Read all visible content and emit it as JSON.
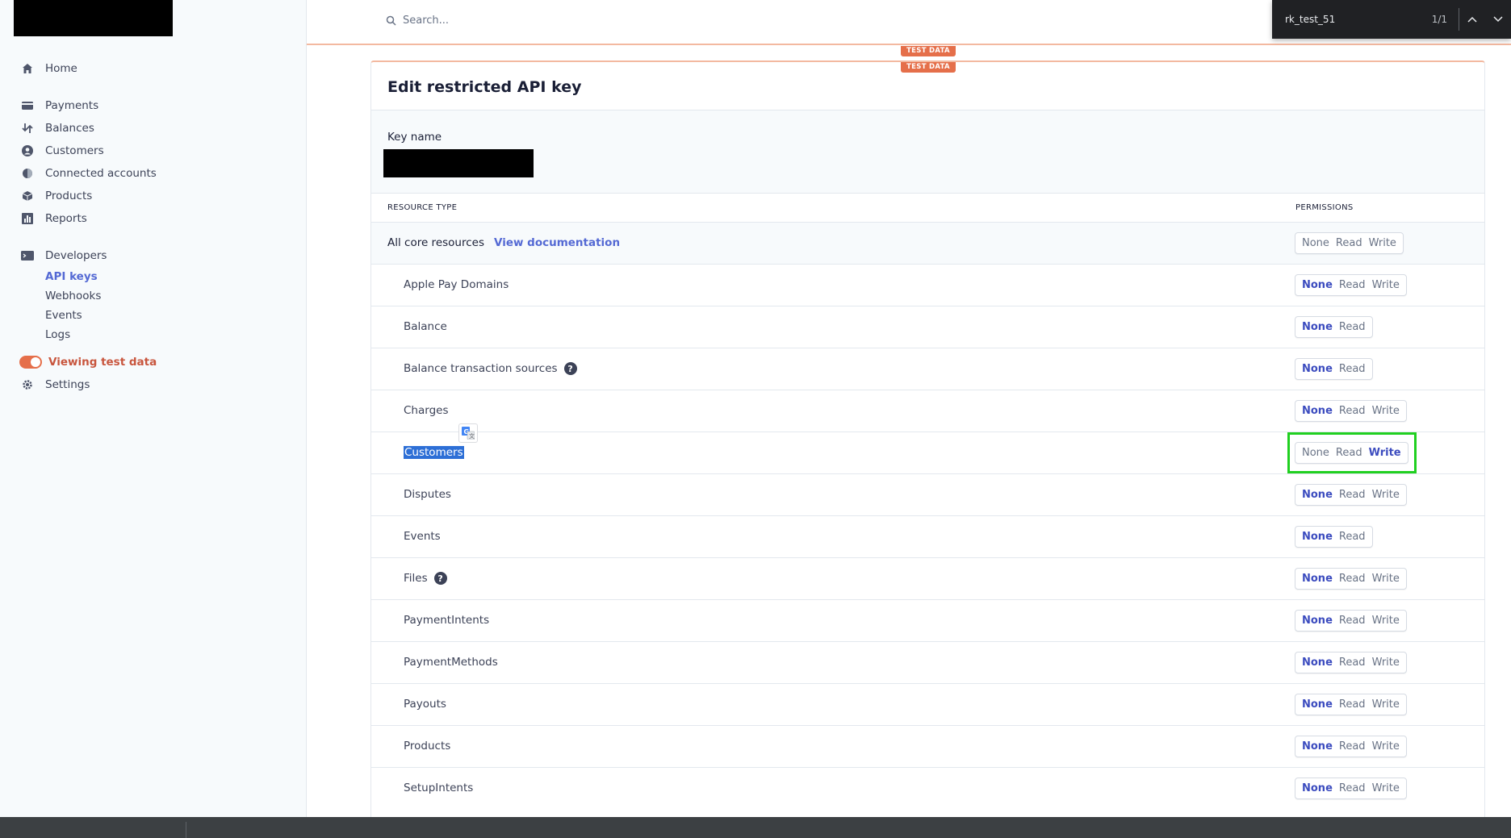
{
  "sidebar": {
    "items": [
      {
        "label": "Home",
        "icon": "home-icon"
      },
      {
        "label": "Payments",
        "icon": "payments-icon"
      },
      {
        "label": "Balances",
        "icon": "balances-icon"
      },
      {
        "label": "Customers",
        "icon": "customers-icon"
      },
      {
        "label": "Connected accounts",
        "icon": "connected-accounts-icon"
      },
      {
        "label": "Products",
        "icon": "products-icon"
      },
      {
        "label": "Reports",
        "icon": "reports-icon"
      },
      {
        "label": "Developers",
        "icon": "developers-icon"
      }
    ],
    "developers_sub": [
      "API keys",
      "Webhooks",
      "Events",
      "Logs"
    ],
    "test_toggle_label": "Viewing test data",
    "settings_label": "Settings"
  },
  "header": {
    "search_placeholder": "Search..."
  },
  "findbar": {
    "query": "rk_test_51",
    "count": "1/1"
  },
  "badges": {
    "test_data": "TEST DATA"
  },
  "card": {
    "title": "Edit restricted API key",
    "key_name_label": "Key name",
    "col_resource": "RESOURCE TYPE",
    "col_permissions": "PERMISSIONS",
    "core_label": "All core resources",
    "core_doc_link": "View documentation",
    "core_options": [
      "None",
      "Read",
      "Write"
    ],
    "rows": [
      {
        "name": "Apple Pay Domains",
        "options": [
          "None",
          "Read",
          "Write"
        ],
        "selected": "None"
      },
      {
        "name": "Balance",
        "options": [
          "None",
          "Read"
        ],
        "selected": "None"
      },
      {
        "name": "Balance transaction sources",
        "options": [
          "None",
          "Read"
        ],
        "selected": "None",
        "help": "?"
      },
      {
        "name": "Charges",
        "options": [
          "None",
          "Read",
          "Write"
        ],
        "selected": "None"
      },
      {
        "name": "Customers",
        "options": [
          "None",
          "Read",
          "Write"
        ],
        "selected": "Write"
      },
      {
        "name": "Disputes",
        "options": [
          "None",
          "Read",
          "Write"
        ],
        "selected": "None"
      },
      {
        "name": "Events",
        "options": [
          "None",
          "Read"
        ],
        "selected": "None"
      },
      {
        "name": "Files",
        "options": [
          "None",
          "Read",
          "Write"
        ],
        "selected": "None",
        "help": "?"
      },
      {
        "name": "PaymentIntents",
        "options": [
          "None",
          "Read",
          "Write"
        ],
        "selected": "None"
      },
      {
        "name": "PaymentMethods",
        "options": [
          "None",
          "Read",
          "Write"
        ],
        "selected": "None"
      },
      {
        "name": "Payouts",
        "options": [
          "None",
          "Read",
          "Write"
        ],
        "selected": "None"
      },
      {
        "name": "Products",
        "options": [
          "None",
          "Read",
          "Write"
        ],
        "selected": "None"
      },
      {
        "name": "SetupIntents",
        "options": [
          "None",
          "Read",
          "Write"
        ],
        "selected": "None"
      }
    ]
  },
  "colors": {
    "accent": "#5469d4",
    "test": "#e56f4a",
    "highlight": "#20d020"
  }
}
